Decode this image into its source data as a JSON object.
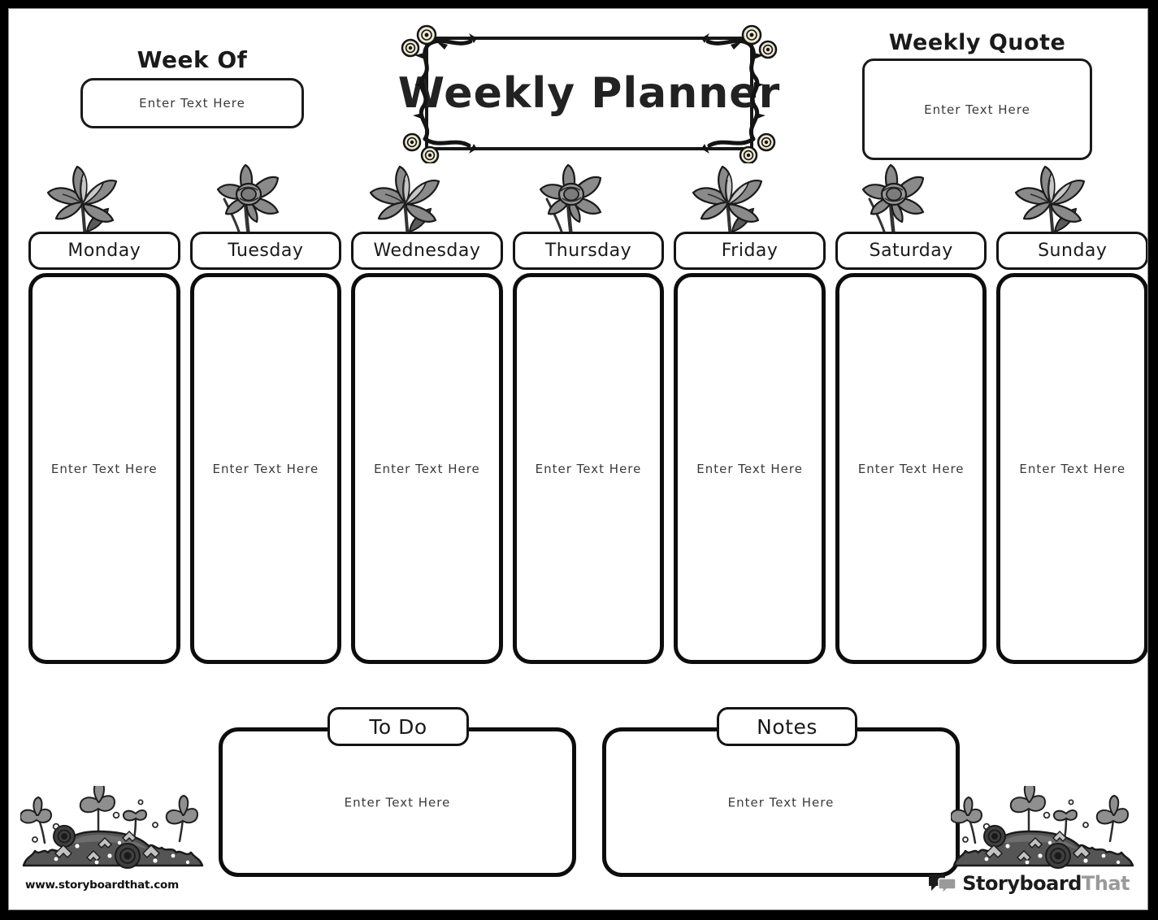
{
  "page": {
    "placeholder_text": "Enter Text Here"
  },
  "title": {
    "text": "Weekly Planner",
    "frame_icon": "rose-vine-frame"
  },
  "week_of": {
    "label": "Week Of",
    "value": "",
    "placeholder": "Enter Text Here"
  },
  "weekly_quote": {
    "label": "Weekly Quote",
    "value": "",
    "placeholder": "Enter Text Here"
  },
  "days": [
    {
      "label": "Monday",
      "placeholder": "Enter Text Here",
      "value": "",
      "flower": "lily-flower"
    },
    {
      "label": "Tuesday",
      "placeholder": "Enter Text Here",
      "value": "",
      "flower": "daffodil-flower"
    },
    {
      "label": "Wednesday",
      "placeholder": "Enter Text Here",
      "value": "",
      "flower": "lily-flower"
    },
    {
      "label": "Thursday",
      "placeholder": "Enter Text Here",
      "value": "",
      "flower": "daffodil-flower"
    },
    {
      "label": "Friday",
      "placeholder": "Enter Text Here",
      "value": "",
      "flower": "lily-flower"
    },
    {
      "label": "Saturday",
      "placeholder": "Enter Text Here",
      "value": "",
      "flower": "daffodil-flower"
    },
    {
      "label": "Sunday",
      "placeholder": "Enter Text Here",
      "value": "",
      "flower": "lily-flower"
    }
  ],
  "todo": {
    "label": "To Do",
    "value": "",
    "placeholder": "Enter Text Here"
  },
  "notes": {
    "label": "Notes",
    "value": "",
    "placeholder": "Enter Text Here"
  },
  "footer": {
    "url": "www.storyboardthat.com",
    "brand_primary": "Storyboard",
    "brand_secondary": "That",
    "logo_icon": "speech-bubbles-logo",
    "decoration_icon": "flower-bush"
  },
  "colors": {
    "ink": "#1a1a1a",
    "page_background": "#ffffff",
    "frame_border": "#000000",
    "flower_mid": "#8a8a8a",
    "flower_light": "#c8c8c8",
    "flower_dark": "#5a5a5a",
    "brand_gray": "#9a9a9a",
    "rose_cream": "#efe9d2"
  }
}
